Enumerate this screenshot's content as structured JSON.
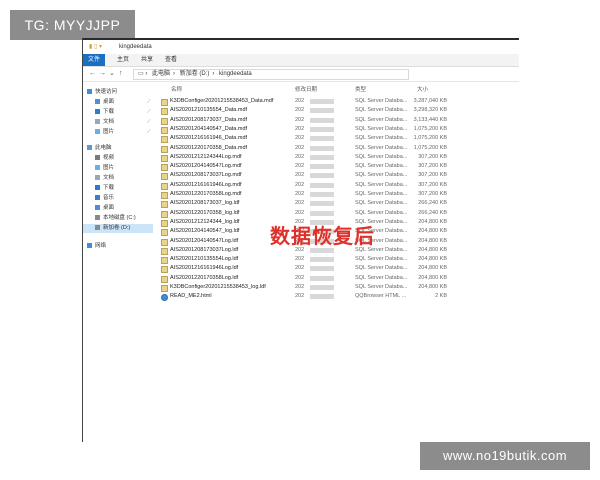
{
  "watermark_top": "TG: MYYJJPP",
  "watermark_bottom": "www.no19butik.com",
  "window": {
    "title": "kingdeedata",
    "ribbon_tabs": [
      "文件",
      "主页",
      "共享",
      "查看"
    ],
    "breadcrumb": [
      "此电脑",
      "新加卷 (D:)",
      "kingdeedata"
    ]
  },
  "nav": {
    "quick_access": "快速访问",
    "quick_items": [
      "桌面",
      "下载",
      "文档",
      "图片"
    ],
    "this_pc": "此电脑",
    "pc_items": [
      "视频",
      "图片",
      "文档",
      "下载",
      "音乐",
      "桌面",
      "本地磁盘 (C:)",
      "新加卷 (D:)"
    ],
    "network": "网络"
  },
  "columns": {
    "name": "名称",
    "date": "修改日期",
    "type": "类型",
    "size": "大小"
  },
  "files": [
    {
      "name": "K3DBConfiger20201215538453_Data.mdf",
      "date": "202",
      "type": "SQL Server Databa...",
      "size": "3,287,040 KB",
      "kind": "db"
    },
    {
      "name": "AIS20201210135554_Data.mdf",
      "date": "202",
      "type": "SQL Server Databa...",
      "size": "3,298,320 KB",
      "kind": "db"
    },
    {
      "name": "AIS20201208173037_Data.mdf",
      "date": "202",
      "type": "SQL Server Databa...",
      "size": "3,133,440 KB",
      "kind": "db"
    },
    {
      "name": "AIS20201204140547_Data.mdf",
      "date": "202",
      "type": "SQL Server Databa...",
      "size": "1,075,200 KB",
      "kind": "db"
    },
    {
      "name": "AIS20201216161946_Data.mdf",
      "date": "202",
      "type": "SQL Server Databa...",
      "size": "1,075,200 KB",
      "kind": "db"
    },
    {
      "name": "AIS20201220170358_Data.mdf",
      "date": "202",
      "type": "SQL Server Databa...",
      "size": "1,075,200 KB",
      "kind": "db"
    },
    {
      "name": "AIS20201212124344Log.mdf",
      "date": "202",
      "type": "SQL Server Databa...",
      "size": "307,200 KB",
      "kind": "db"
    },
    {
      "name": "AIS20201204140547Log.mdf",
      "date": "202",
      "type": "SQL Server Databa...",
      "size": "307,200 KB",
      "kind": "db"
    },
    {
      "name": "AIS20201208173037Log.mdf",
      "date": "202",
      "type": "SQL Server Databa...",
      "size": "307,200 KB",
      "kind": "db"
    },
    {
      "name": "AIS20201216161946Log.mdf",
      "date": "202",
      "type": "SQL Server Databa...",
      "size": "307,200 KB",
      "kind": "db"
    },
    {
      "name": "AIS20201220170358Log.mdf",
      "date": "202",
      "type": "SQL Server Databa...",
      "size": "307,200 KB",
      "kind": "db"
    },
    {
      "name": "AIS20201208173037_log.ldf",
      "date": "202",
      "type": "SQL Server Databa...",
      "size": "266,240 KB",
      "kind": "db"
    },
    {
      "name": "AIS20201220170358_log.ldf",
      "date": "202",
      "type": "SQL Server Databa...",
      "size": "266,240 KB",
      "kind": "db"
    },
    {
      "name": "AIS20201212124344_log.ldf",
      "date": "202",
      "type": "SQL Server Databa...",
      "size": "204,800 KB",
      "kind": "db"
    },
    {
      "name": "AIS20201204140547_log.ldf",
      "date": "202",
      "type": "SQL Server Databa...",
      "size": "204,800 KB",
      "kind": "db"
    },
    {
      "name": "AIS20201204140547Log.ldf",
      "date": "202",
      "type": "SQL Server Databa...",
      "size": "204,800 KB",
      "kind": "db"
    },
    {
      "name": "AIS20201208173037Log.ldf",
      "date": "202",
      "type": "SQL Server Databa...",
      "size": "204,800 KB",
      "kind": "db"
    },
    {
      "name": "AIS20201210135554Log.ldf",
      "date": "202",
      "type": "SQL Server Databa...",
      "size": "204,800 KB",
      "kind": "db"
    },
    {
      "name": "AIS20201216161946Log.ldf",
      "date": "202",
      "type": "SQL Server Databa...",
      "size": "204,800 KB",
      "kind": "db"
    },
    {
      "name": "AIS20201220170358Log.ldf",
      "date": "202",
      "type": "SQL Server Databa...",
      "size": "204,800 KB",
      "kind": "db"
    },
    {
      "name": "K3DBConfiger20201215538453_log.ldf",
      "date": "202",
      "type": "SQL Server Databa...",
      "size": "204,800 KB",
      "kind": "db"
    },
    {
      "name": "READ_ME2.html",
      "date": "202",
      "type": "QQBrowser HTML ...",
      "size": "2 KB",
      "kind": "html"
    }
  ],
  "overlay_text": "数据恢复后",
  "colors": {
    "accent": "#1a6fc4",
    "overlay": "#e0302a",
    "watermark_bg": "#8c8c8c"
  }
}
